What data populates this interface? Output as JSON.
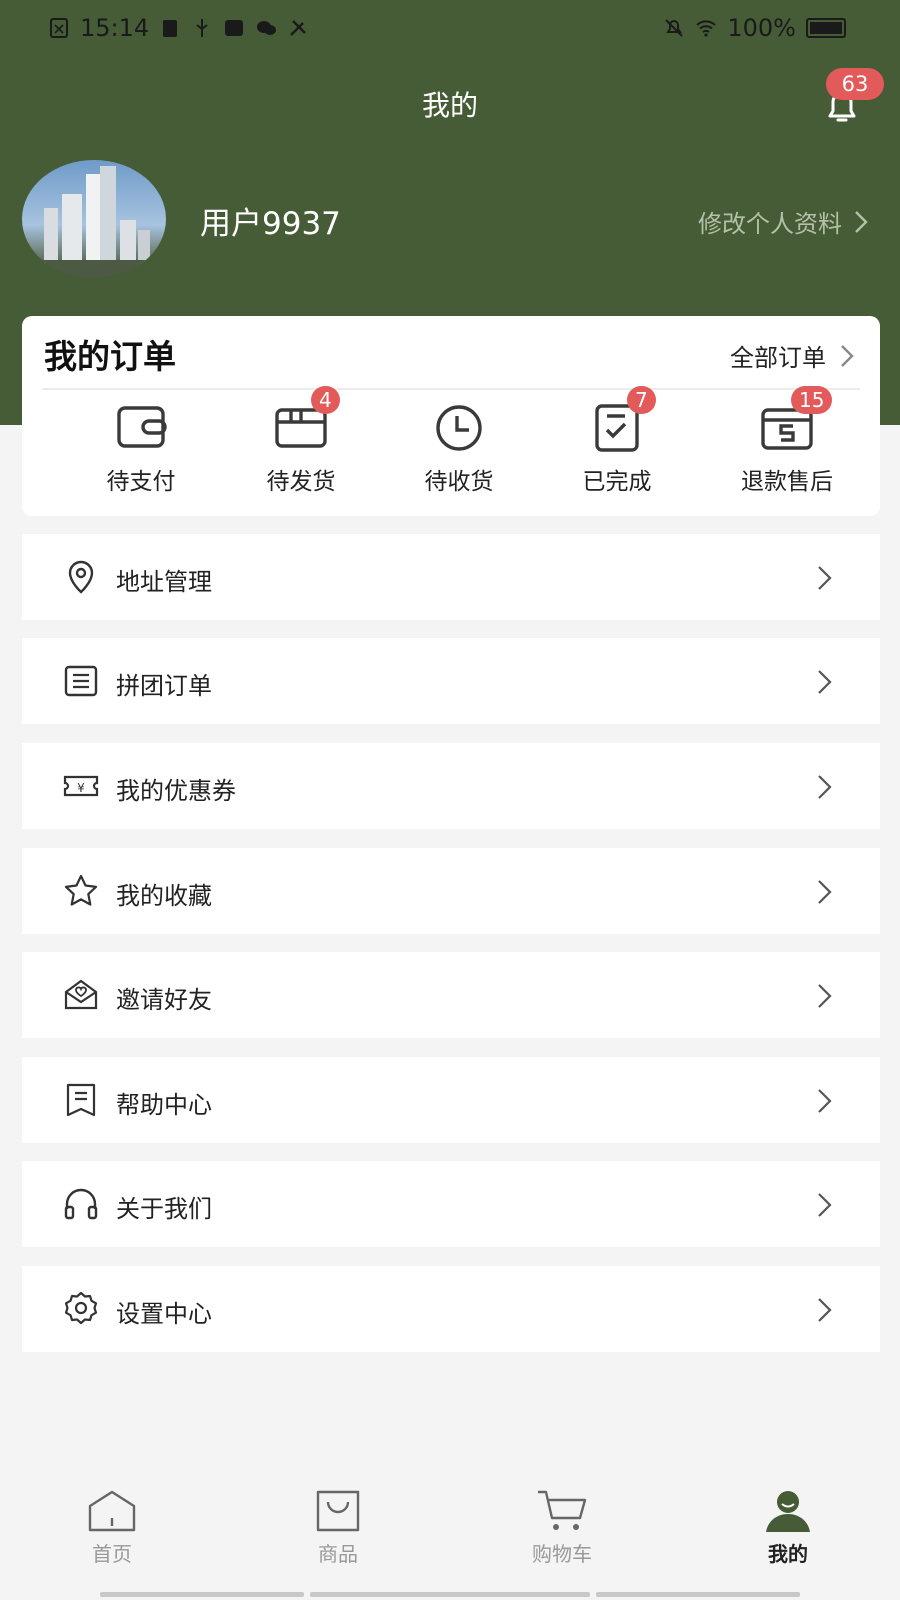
{
  "status_bar": {
    "time": "15:14",
    "battery": "100%"
  },
  "header": {
    "title": "我的",
    "notification_count": "63"
  },
  "profile": {
    "username": "用户9937",
    "edit_label": "修改个人资料"
  },
  "orders": {
    "title": "我的订单",
    "all_label": "全部订单",
    "items": [
      {
        "label": "待支付",
        "badge": ""
      },
      {
        "label": "待发货",
        "badge": "4"
      },
      {
        "label": "待收货",
        "badge": ""
      },
      {
        "label": "已完成",
        "badge": "7"
      },
      {
        "label": "退款售后",
        "badge": "15"
      }
    ]
  },
  "menu": [
    {
      "label": "地址管理",
      "icon": "location-icon"
    },
    {
      "label": "拼团订单",
      "icon": "list-icon"
    },
    {
      "label": "我的优惠券",
      "icon": "coupon-icon"
    },
    {
      "label": "我的收藏",
      "icon": "star-icon"
    },
    {
      "label": "邀请好友",
      "icon": "invite-icon"
    },
    {
      "label": "帮助中心",
      "icon": "help-icon"
    },
    {
      "label": "关于我们",
      "icon": "headset-icon"
    },
    {
      "label": "设置中心",
      "icon": "gear-icon"
    }
  ],
  "bottom_nav": [
    {
      "label": "首页",
      "icon": "home-icon"
    },
    {
      "label": "商品",
      "icon": "bag-icon"
    },
    {
      "label": "购物车",
      "icon": "cart-icon"
    },
    {
      "label": "我的",
      "icon": "user-icon"
    }
  ],
  "colors": {
    "header_bg": "#465c36",
    "badge": "#e25a5a"
  }
}
